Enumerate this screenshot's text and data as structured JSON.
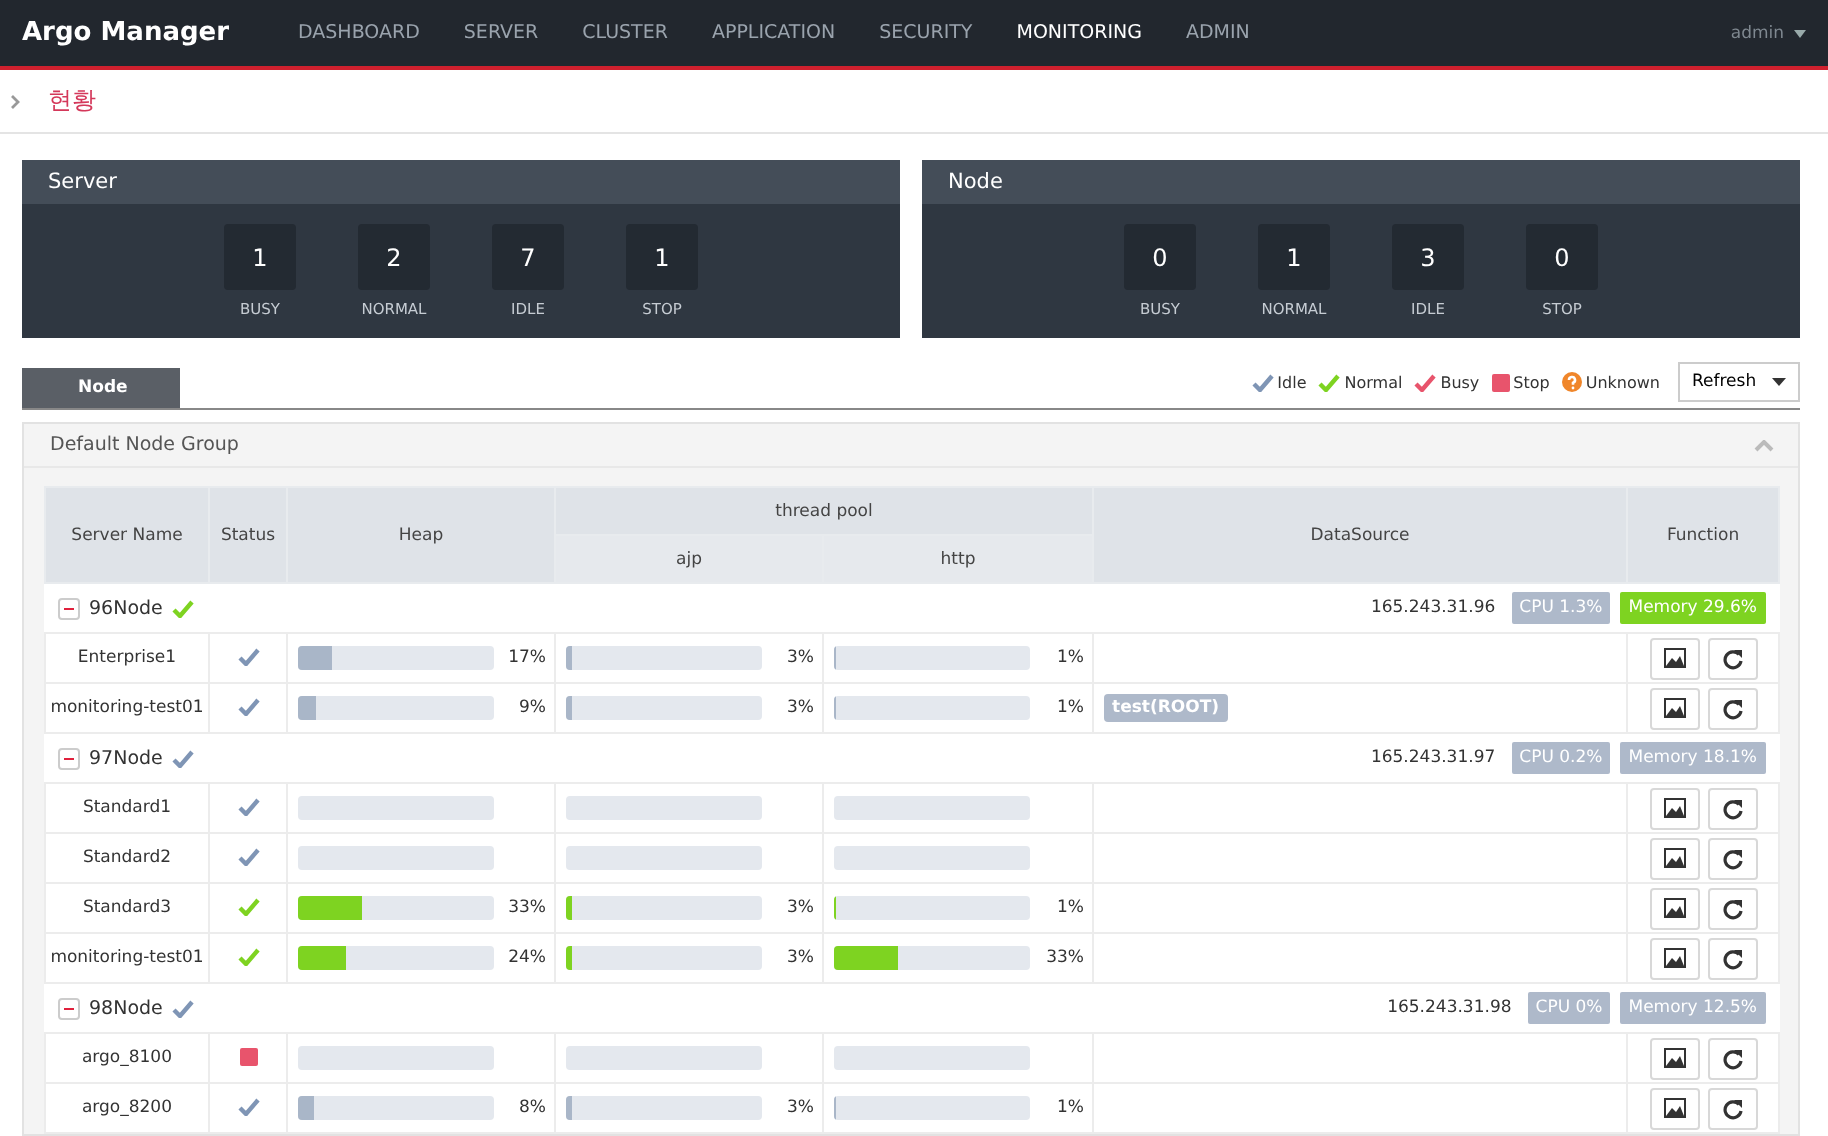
{
  "app": {
    "title": "Argo Manager",
    "user": "admin",
    "nav": [
      {
        "label": "DASHBOARD",
        "selected": false
      },
      {
        "label": "SERVER",
        "selected": false
      },
      {
        "label": "CLUSTER",
        "selected": false
      },
      {
        "label": "APPLICATION",
        "selected": false
      },
      {
        "label": "SECURITY",
        "selected": false
      },
      {
        "label": "MONITORING",
        "selected": true
      },
      {
        "label": "ADMIN",
        "selected": false
      }
    ]
  },
  "breadcrumb": {
    "title": "현황"
  },
  "summary": [
    {
      "title": "Server",
      "counts": [
        {
          "value": "1",
          "label": "BUSY"
        },
        {
          "value": "2",
          "label": "NORMAL"
        },
        {
          "value": "7",
          "label": "IDLE"
        },
        {
          "value": "1",
          "label": "STOP"
        }
      ]
    },
    {
      "title": "Node",
      "counts": [
        {
          "value": "0",
          "label": "BUSY"
        },
        {
          "value": "1",
          "label": "NORMAL"
        },
        {
          "value": "3",
          "label": "IDLE"
        },
        {
          "value": "0",
          "label": "STOP"
        }
      ]
    }
  ],
  "tabs": [
    {
      "label": "Node",
      "selected": true
    }
  ],
  "legend": [
    {
      "kind": "idle",
      "label": "Idle"
    },
    {
      "kind": "normal",
      "label": "Normal"
    },
    {
      "kind": "busy",
      "label": "Busy"
    },
    {
      "kind": "stop",
      "label": "Stop"
    },
    {
      "kind": "unknown",
      "label": "Unknown"
    }
  ],
  "refresh_button": "Refresh",
  "group": {
    "title": "Default Node Group",
    "expanded": true,
    "columns": {
      "server_name": "Server Name",
      "status": "Status",
      "heap": "Heap",
      "thread_pool": "thread pool",
      "ajp": "ajp",
      "http": "http",
      "datasource": "DataSource",
      "function": "Function"
    },
    "nodes": [
      {
        "name": "96Node",
        "kind": "normal",
        "expanded": true,
        "ip": "165.243.31.96",
        "badges": [
          {
            "label": "CPU 1.3%",
            "highlighted": false
          },
          {
            "label": "Memory 29.6%",
            "highlighted": true
          }
        ],
        "servers": [
          {
            "name": "Enterprise1",
            "kind": "idle",
            "heap": {
              "level": 0.17,
              "reading": "17%"
            },
            "ajp": {
              "level": 0.03,
              "reading": "3%"
            },
            "http": {
              "level": 0.01,
              "reading": "1%"
            }
          },
          {
            "name": "monitoring-test01",
            "kind": "idle",
            "heap": {
              "level": 0.09,
              "reading": "9%"
            },
            "ajp": {
              "level": 0.03,
              "reading": "3%"
            },
            "http": {
              "level": 0.01,
              "reading": "1%"
            },
            "datasources": [
              "test(ROOT)"
            ]
          }
        ]
      },
      {
        "name": "97Node",
        "kind": "idle",
        "expanded": true,
        "ip": "165.243.31.97",
        "badges": [
          {
            "label": "CPU 0.2%",
            "highlighted": false
          },
          {
            "label": "Memory 18.1%",
            "highlighted": false
          }
        ],
        "servers": [
          {
            "name": "Standard1",
            "kind": "idle",
            "heap": {
              "level": 0
            },
            "ajp": {
              "level": 0
            },
            "http": {
              "level": 0
            }
          },
          {
            "name": "Standard2",
            "kind": "idle",
            "heap": {
              "level": 0
            },
            "ajp": {
              "level": 0
            },
            "http": {
              "level": 0
            }
          },
          {
            "name": "Standard3",
            "kind": "normal",
            "heap": {
              "level": 0.33,
              "reading": "33%"
            },
            "ajp": {
              "level": 0.03,
              "reading": "3%"
            },
            "http": {
              "level": 0.01,
              "reading": "1%"
            }
          },
          {
            "name": "monitoring-test01",
            "kind": "normal",
            "heap": {
              "level": 0.24,
              "reading": "24%"
            },
            "ajp": {
              "level": 0.03,
              "reading": "3%"
            },
            "http": {
              "level": 0.33,
              "reading": "33%"
            }
          }
        ]
      },
      {
        "name": "98Node",
        "kind": "idle",
        "expanded": true,
        "ip": "165.243.31.98",
        "badges": [
          {
            "label": "CPU 0%",
            "highlighted": false
          },
          {
            "label": "Memory 12.5%",
            "highlighted": false
          }
        ],
        "servers": [
          {
            "name": "argo_8100",
            "kind": "stop",
            "heap": {
              "level": 0
            },
            "ajp": {
              "level": 0
            },
            "http": {
              "level": 0
            }
          },
          {
            "name": "argo_8200",
            "kind": "idle",
            "heap": {
              "level": 0.08,
              "reading": "8%"
            },
            "ajp": {
              "level": 0.03,
              "reading": "3%"
            },
            "http": {
              "level": 0.01,
              "reading": "1%"
            }
          }
        ]
      }
    ]
  }
}
